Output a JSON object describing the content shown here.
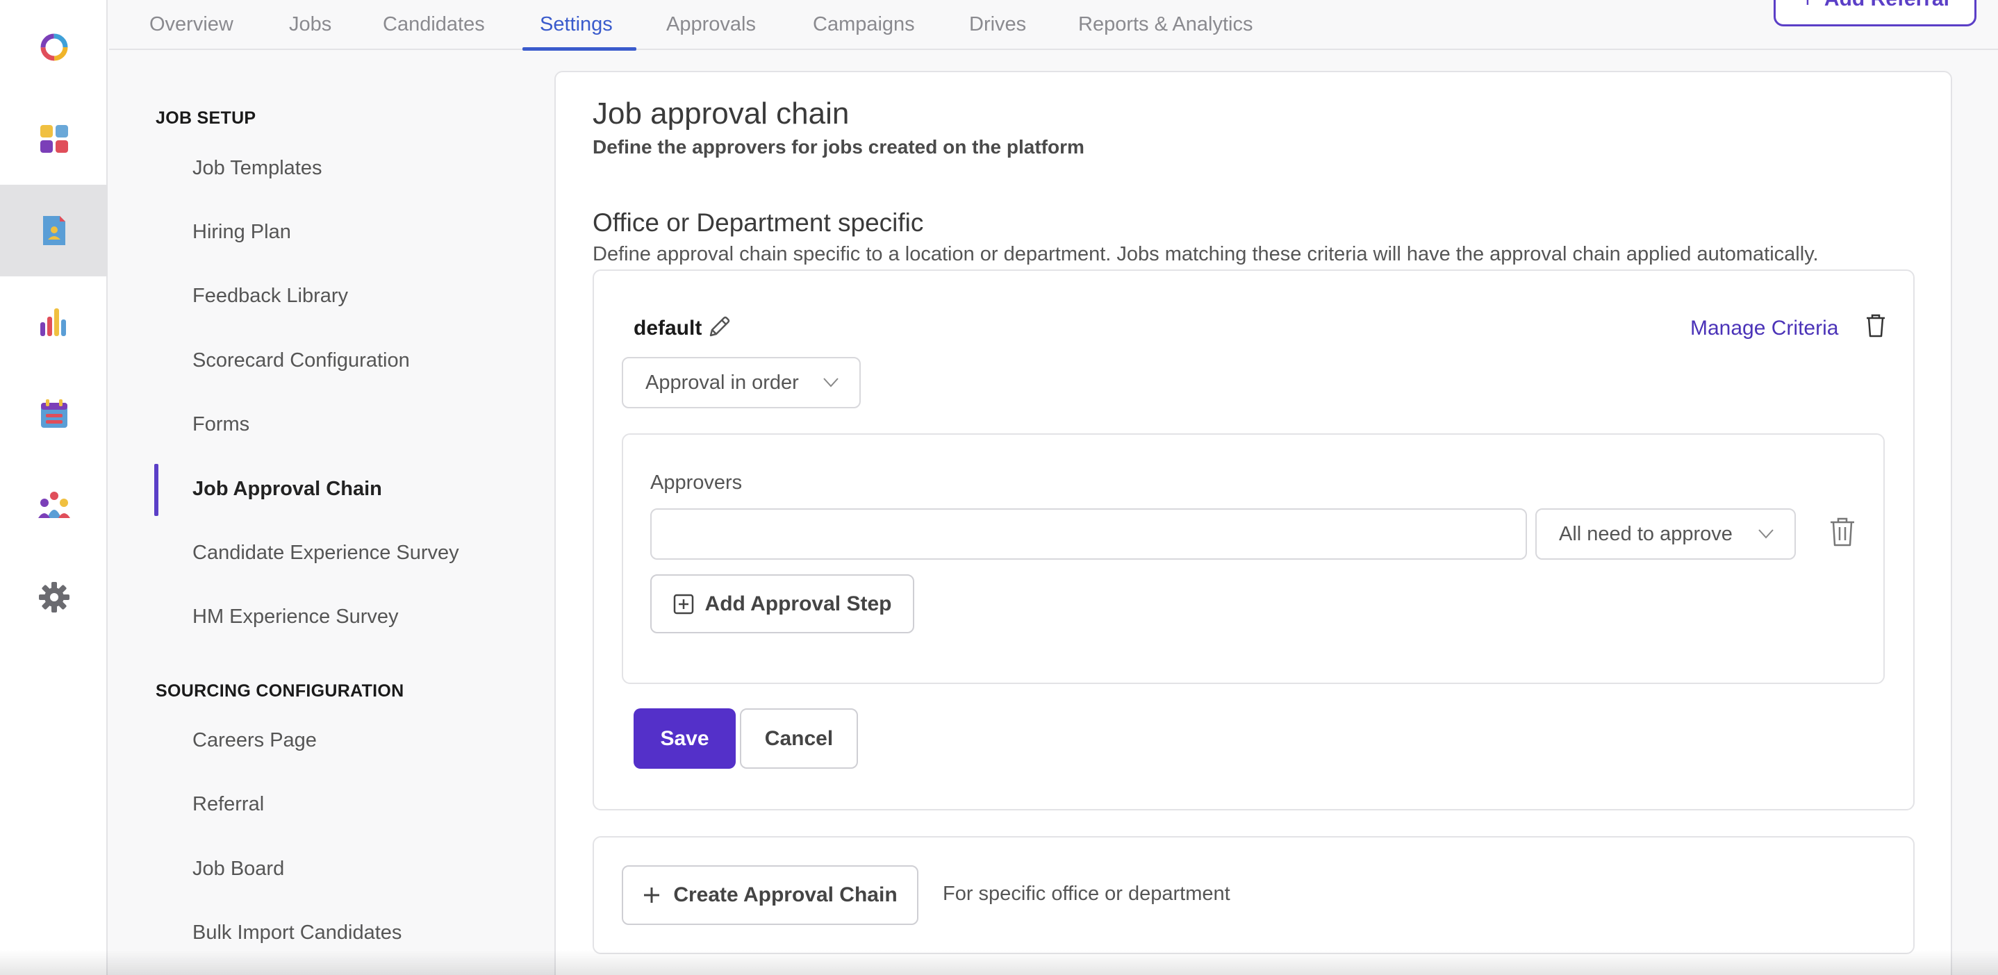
{
  "rail": {
    "items": [
      {
        "icon": "brand-logo-icon",
        "active": false
      },
      {
        "icon": "dashboard-icon",
        "active": false
      },
      {
        "icon": "candidate-file-icon",
        "active": true
      },
      {
        "icon": "reports-chart-icon",
        "active": false
      },
      {
        "icon": "calendar-icon",
        "active": false
      },
      {
        "icon": "team-icon",
        "active": false
      },
      {
        "icon": "gear-icon",
        "active": false
      }
    ]
  },
  "topnav": {
    "tabs": [
      {
        "label": "Overview"
      },
      {
        "label": "Jobs"
      },
      {
        "label": "Candidates"
      },
      {
        "label": "Settings",
        "active": true
      },
      {
        "label": "Approvals"
      },
      {
        "label": "Campaigns"
      },
      {
        "label": "Drives"
      },
      {
        "label": "Reports & Analytics"
      }
    ],
    "add_referral_label": "Add Referral"
  },
  "sidebar": {
    "job_setup_title": "JOB SETUP",
    "job_setup_items": [
      {
        "label": "Job Templates"
      },
      {
        "label": "Hiring Plan"
      },
      {
        "label": "Feedback Library"
      },
      {
        "label": "Scorecard Configuration"
      },
      {
        "label": "Forms"
      },
      {
        "label": "Job Approval Chain",
        "active": true
      },
      {
        "label": "Candidate Experience Survey"
      },
      {
        "label": "HM Experience Survey"
      }
    ],
    "sourcing_title": "SOURCING CONFIGURATION",
    "sourcing_items": [
      {
        "label": "Careers Page"
      },
      {
        "label": "Referral"
      },
      {
        "label": "Job Board"
      },
      {
        "label": "Bulk Import Candidates"
      }
    ]
  },
  "main": {
    "title": "Job approval chain",
    "subtitle": "Define the approvers for jobs created on the platform",
    "section_title": "Office or Department specific",
    "section_desc": "Define approval chain specific to a location or department. Jobs matching these criteria will have the approval chain applied automatically.",
    "chain": {
      "name": "default",
      "manage_criteria_label": "Manage Criteria",
      "order_mode": "Approval in order",
      "approvers_label": "Approvers",
      "approver_value": "",
      "approval_rule": "All need to approve",
      "add_step_label": "Add Approval Step",
      "save_label": "Save",
      "cancel_label": "Cancel"
    },
    "create": {
      "button_label": "Create Approval Chain",
      "note": "For specific office or department"
    }
  },
  "colors": {
    "accent": "#5430c9",
    "tab_active": "#3a5bcc",
    "link": "#4b33b8"
  }
}
